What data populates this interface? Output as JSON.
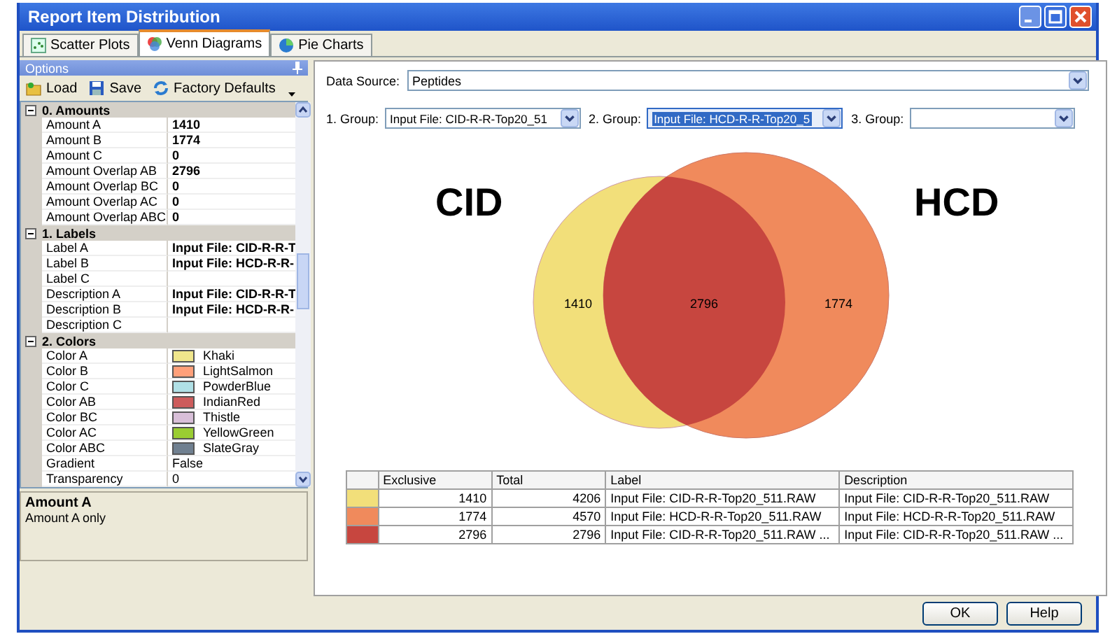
{
  "window": {
    "title": "Report Item Distribution"
  },
  "tabs": [
    {
      "label": "Scatter Plots",
      "selected": false
    },
    {
      "label": "Venn Diagrams",
      "selected": true
    },
    {
      "label": "Pie Charts",
      "selected": false
    }
  ],
  "options": {
    "title": "Options",
    "toolbar": [
      "Load",
      "Save",
      "Factory Defaults"
    ],
    "categories": [
      {
        "title": "0. Amounts",
        "expanded": true,
        "rows": [
          {
            "name": "Amount A",
            "value": "1410",
            "kind": "bold"
          },
          {
            "name": "Amount B",
            "value": "1774",
            "kind": "bold"
          },
          {
            "name": "Amount C",
            "value": "0",
            "kind": "bold"
          },
          {
            "name": "Amount Overlap AB",
            "value": "2796",
            "kind": "bold"
          },
          {
            "name": "Amount Overlap BC",
            "value": "0",
            "kind": "bold"
          },
          {
            "name": "Amount Overlap AC",
            "value": "0",
            "kind": "bold"
          },
          {
            "name": "Amount Overlap ABC",
            "value": "0",
            "kind": "bold"
          }
        ]
      },
      {
        "title": "1. Labels",
        "expanded": true,
        "rows": [
          {
            "name": "Label A",
            "value": "Input File: CID-R-R-T",
            "kind": "bold"
          },
          {
            "name": "Label B",
            "value": "Input File: HCD-R-R-",
            "kind": "bold"
          },
          {
            "name": "Label C",
            "kind": "bold"
          },
          {
            "name": "Description A",
            "value": "Input File: CID-R-R-T",
            "kind": "bold"
          },
          {
            "name": "Description B",
            "value": "Input File: HCD-R-R-",
            "kind": "bold"
          },
          {
            "name": "Description C",
            "kind": "bold"
          }
        ]
      },
      {
        "title": "2. Colors",
        "expanded": true,
        "rows": [
          {
            "name": "Color A",
            "value": "Khaki",
            "kind": "color",
            "color": "#f0e68c"
          },
          {
            "name": "Color B",
            "value": "LightSalmon",
            "kind": "color",
            "color": "#ffa07a"
          },
          {
            "name": "Color C",
            "value": "PowderBlue",
            "kind": "color",
            "color": "#b0e0e6"
          },
          {
            "name": "Color AB",
            "value": "IndianRed",
            "kind": "color",
            "color": "#cd5c5c"
          },
          {
            "name": "Color BC",
            "value": "Thistle",
            "kind": "color",
            "color": "#d8bfd8"
          },
          {
            "name": "Color AC",
            "value": "YellowGreen",
            "kind": "color",
            "color": "#9acd32"
          },
          {
            "name": "Color ABC",
            "value": "SlateGray",
            "kind": "color",
            "color": "#708090"
          },
          {
            "name": "Gradient",
            "value": "False",
            "kind": "plain"
          },
          {
            "name": "Transparency",
            "value": "0",
            "kind": "plain"
          }
        ]
      }
    ],
    "help": {
      "title": "Amount A",
      "text": "Amount A only"
    }
  },
  "data_source": {
    "label": "Data Source:",
    "value": "Peptides"
  },
  "groups": [
    {
      "label": "1. Group:",
      "value": "Input File: CID-R-R-Top20_51",
      "focused": false
    },
    {
      "label": "2. Group:",
      "value": "Input File: HCD-R-R-Top20_5",
      "focused": true
    },
    {
      "label": "3. Group:",
      "focused": false
    }
  ],
  "venn": {
    "sets": [
      {
        "name": "CID",
        "count": "1410",
        "color": "#f2df7a"
      },
      {
        "name": "HCD",
        "count": "1774",
        "color": "#f08a5c"
      }
    ],
    "overlap": {
      "count": "2796",
      "color": "#c7463f"
    }
  },
  "table": {
    "columns": [
      "Exclusive",
      "Total",
      "Label",
      "Description"
    ],
    "rows": [
      {
        "color": "#f2df7a",
        "cells": [
          "1410",
          "4206",
          "Input File: CID-R-R-Top20_511.RAW",
          "Input File: CID-R-R-Top20_511.RAW"
        ]
      },
      {
        "color": "#f08a5c",
        "cells": [
          "1774",
          "4570",
          "Input File: HCD-R-R-Top20_511.RAW",
          "Input File: HCD-R-R-Top20_511.RAW"
        ]
      },
      {
        "color": "#c7463f",
        "cells": [
          "2796",
          "2796",
          "Input File: CID-R-R-Top20_511.RAW ...",
          "Input File: CID-R-R-Top20_511.RAW ..."
        ]
      }
    ]
  },
  "buttons": [
    "OK",
    "Help"
  ]
}
